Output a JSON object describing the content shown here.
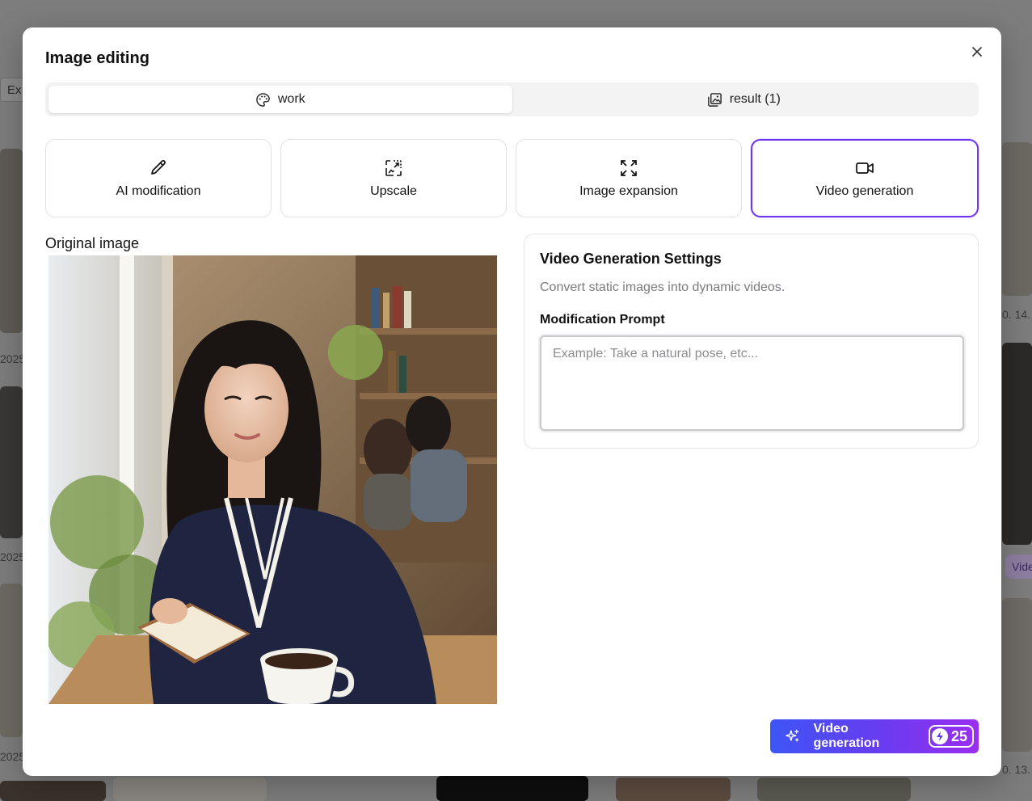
{
  "modal": {
    "title": "Image editing",
    "close_icon": "x-icon"
  },
  "tabs": [
    {
      "label": "work",
      "icon": "palette-icon",
      "active": true
    },
    {
      "label": "result (1)",
      "icon": "images-icon",
      "active": false
    }
  ],
  "tools": [
    {
      "label": "AI modification",
      "icon": "pencil-icon",
      "active": false
    },
    {
      "label": "Upscale",
      "icon": "upscale-icon",
      "active": false
    },
    {
      "label": "Image expansion",
      "icon": "expand-icon",
      "active": false
    },
    {
      "label": "Video generation",
      "icon": "video-camera-icon",
      "active": true
    }
  ],
  "original": {
    "label": "Original image"
  },
  "settings": {
    "title": "Video Generation Settings",
    "description": "Convert static images into dynamic videos.",
    "prompt_label": "Modification Prompt",
    "prompt_placeholder": "Example: Take a natural pose, etc...",
    "prompt_value": ""
  },
  "generate": {
    "label": "Video generation",
    "credits": "25",
    "icon": "sparkles-icon",
    "credit_icon": "lightning-icon"
  },
  "background": {
    "chip_text": "Ex",
    "texts": [
      "2025",
      "2025",
      "2025",
      "0. 14.",
      "0. 13."
    ],
    "badge": "Vide"
  },
  "colors": {
    "accent": "#6d35f0",
    "gradient_start": "#3d55f5",
    "gradient_end": "#9a2ff0"
  }
}
